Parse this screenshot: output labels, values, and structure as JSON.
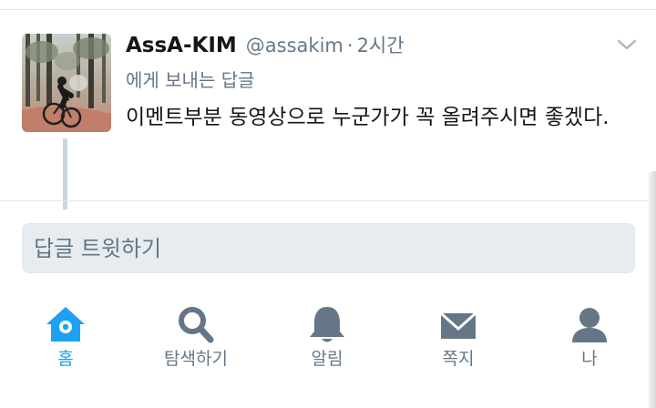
{
  "tweet": {
    "author_name": "AssA-KIM",
    "author_handle": "@assakim",
    "separator": "·",
    "time": "2시간",
    "reply_context": "에게 보내는 답글",
    "text": "이멘트부분 동영상으로 누군가가 꼭 올려주시면 좋겠다."
  },
  "reply": {
    "placeholder": "답글 트윗하기"
  },
  "tabs": [
    {
      "label": "홈",
      "icon": "home-icon",
      "active": true
    },
    {
      "label": "탐색하기",
      "icon": "search-icon",
      "active": false
    },
    {
      "label": "알림",
      "icon": "bell-icon",
      "active": false
    },
    {
      "label": "쪽지",
      "icon": "envelope-icon",
      "active": false
    },
    {
      "label": "나",
      "icon": "person-icon",
      "active": false
    }
  ],
  "colors": {
    "accent": "#1da1f2",
    "icon_gray": "#657786",
    "text_primary": "#14171a",
    "reply_bg": "#e6ecf0"
  }
}
